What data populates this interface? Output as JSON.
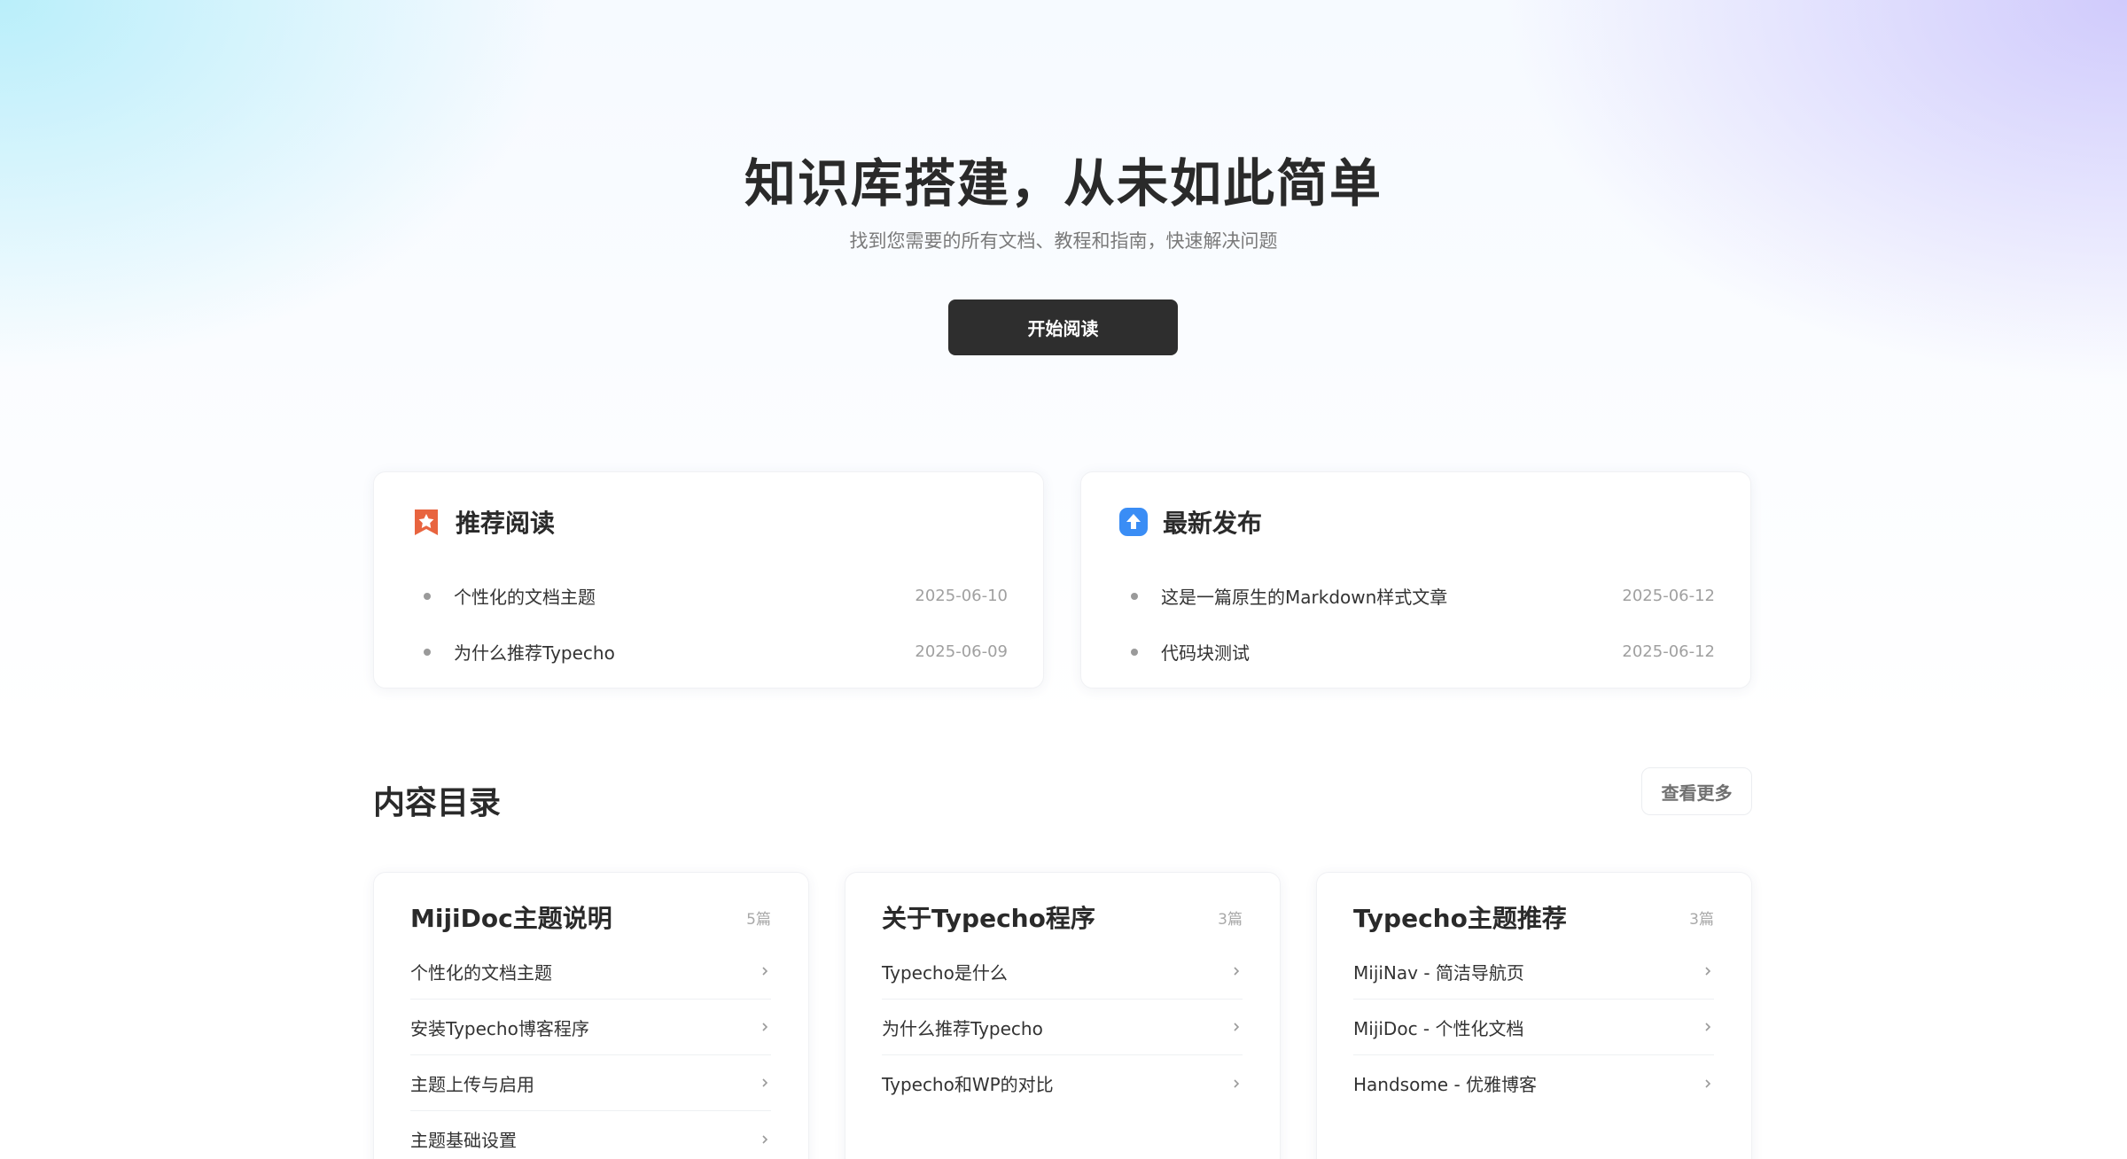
{
  "hero": {
    "title": "知识库搭建，从未如此简单",
    "subtitle": "找到您需要的所有文档、教程和指南，快速解决问题",
    "button_label": "开始阅读"
  },
  "featured": {
    "recommended": {
      "title": "推荐阅读",
      "icon": "star-ribbon-icon",
      "icon_color": "#e8643f",
      "items": [
        {
          "title": "个性化的文档主题",
          "date": "2025-06-10"
        },
        {
          "title": "为什么推荐Typecho",
          "date": "2025-06-09"
        }
      ]
    },
    "latest": {
      "title": "最新发布",
      "icon": "upload-arrow-icon",
      "icon_color": "#3a8df5",
      "items": [
        {
          "title": "这是一篇原生的Markdown样式文章",
          "date": "2025-06-12"
        },
        {
          "title": "代码块测试",
          "date": "2025-06-12"
        }
      ]
    }
  },
  "toc": {
    "title": "内容目录",
    "more_label": "查看更多",
    "categories": [
      {
        "title": "MijiDoc主题说明",
        "count": "5篇",
        "items": [
          "个性化的文档主题",
          "安装Typecho博客程序",
          "主题上传与启用",
          "主题基础设置"
        ]
      },
      {
        "title": "关于Typecho程序",
        "count": "3篇",
        "items": [
          "Typecho是什么",
          "为什么推荐Typecho",
          "Typecho和WP的对比"
        ]
      },
      {
        "title": "Typecho主题推荐",
        "count": "3篇",
        "items": [
          "MijiNav - 简洁导航页",
          "MijiDoc - 个性化文档",
          "Handsome - 优雅博客"
        ]
      }
    ]
  }
}
